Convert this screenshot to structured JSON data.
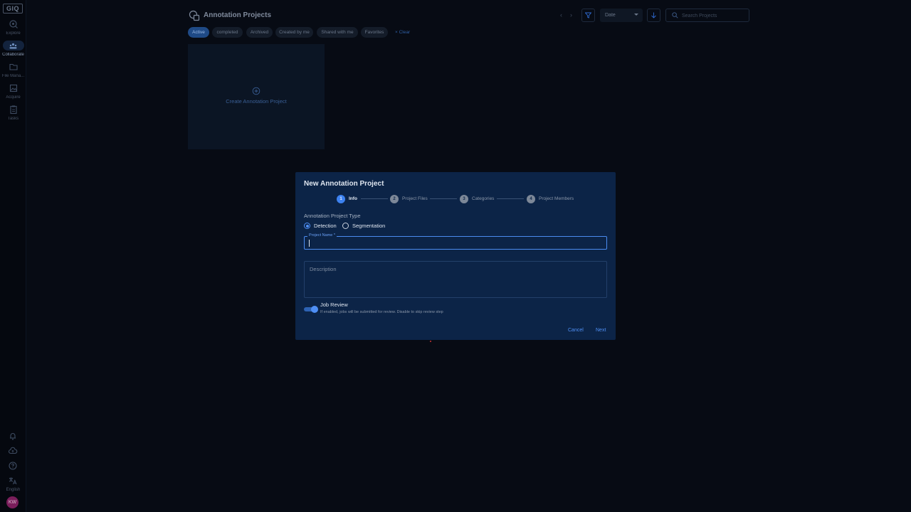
{
  "sidebar": {
    "logo": "GIQ",
    "items": [
      {
        "label": "Explore",
        "icon": "explore-icon"
      },
      {
        "label": "Collaborate",
        "icon": "collaborate-icon",
        "active": true
      },
      {
        "label": "File Mana...",
        "icon": "folder-icon"
      },
      {
        "label": "Acquire",
        "icon": "image-icon"
      },
      {
        "label": "Tasks",
        "icon": "clipboard-icon"
      }
    ],
    "bottom": {
      "language": "English",
      "avatar_initials": "KW"
    }
  },
  "header": {
    "title": "Annotation Projects",
    "sort_select": "Date",
    "search_placeholder": "Search Projects"
  },
  "filters": {
    "chips": [
      "Active",
      "completed",
      "Archived",
      "Created by me",
      "Shared with me",
      "Favorites"
    ],
    "active_chip": "Active",
    "clear_label": "Clear"
  },
  "create_card": {
    "label": "Create Annotation Project"
  },
  "dialog": {
    "title": "New Annotation Project",
    "steps": [
      {
        "number": "1",
        "label": "Info",
        "active": true
      },
      {
        "number": "2",
        "label": "Project Files"
      },
      {
        "number": "3",
        "label": "Categories"
      },
      {
        "number": "4",
        "label": "Project Members"
      }
    ],
    "type_label": "Annotation Project Type",
    "type_options": [
      "Detection",
      "Segmentation"
    ],
    "type_selected": "Detection",
    "name_label": "Project Name *",
    "name_value": "",
    "description_placeholder": "Description",
    "job_review": {
      "title": "Job Review",
      "description": "If enabled, jobs will be submitted for review. Disable to skip review step",
      "enabled": true
    },
    "cancel_label": "Cancel",
    "next_label": "Next"
  },
  "colors": {
    "accent": "#3d82f0",
    "dialog_bg": "#0c2447",
    "page_bg": "#070b14",
    "avatar": "#7a1e5b"
  }
}
